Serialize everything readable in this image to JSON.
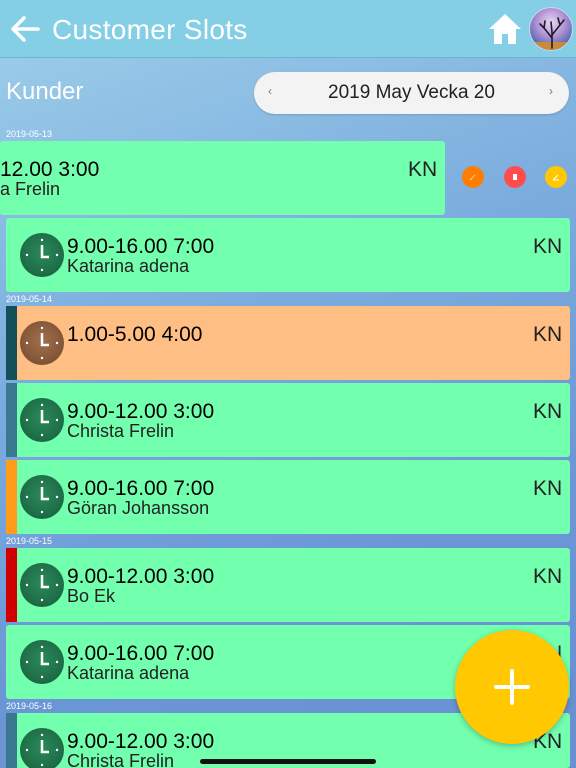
{
  "header": {
    "title": "Customer Slots",
    "back_icon": "arrow-left-icon",
    "home_icon": "home-icon",
    "avatar_icon": "tree-avatar-icon"
  },
  "subheader": {
    "label": "Kunder",
    "week_label": "2019 May Vecka 20",
    "prev": "‹",
    "next": "›"
  },
  "dates": [
    "2019-05-13",
    "2019-05-14",
    "2019-05-15",
    "2019-05-16"
  ],
  "slots": [
    {
      "time": "12.00 3:00",
      "name": "a Frelin",
      "initials": "KN",
      "color": "#72ffae"
    },
    {
      "time": "9.00-16.00 7:00",
      "name": "Katarina adena",
      "initials": "KN",
      "color": "#72ffae"
    },
    {
      "time": "1.00-5.00 4:00",
      "name": "",
      "initials": "KN",
      "color": "#ffbe84",
      "accent": "#14505a"
    },
    {
      "time": "9.00-12.00 3:00",
      "name": "Christa Frelin",
      "initials": "KN",
      "color": "#72ffae",
      "accent": "#3a7891"
    },
    {
      "time": "9.00-16.00 7:00",
      "name": "Göran Johansson",
      "initials": "KN",
      "color": "#72ffae",
      "accent": "#ff9d1a"
    },
    {
      "time": "9.00-12.00 3:00",
      "name": "Bo Ek",
      "initials": "KN",
      "color": "#72ffae",
      "accent": "#d10000"
    },
    {
      "time": "9.00-16.00 7:00",
      "name": "Katarina adena",
      "initials": "KN",
      "color": "#72ffae"
    },
    {
      "time": "9.00-12.00 3:00",
      "name": "Christa Frelin",
      "initials": "KN",
      "color": "#72ffae",
      "accent": "#3a7891"
    }
  ],
  "swipe_actions": {
    "colors": [
      "#ff7d00",
      "#ff4d4d",
      "#ffc800"
    ],
    "icons": [
      "edit-icon",
      "delete-icon",
      "edit-note-icon"
    ]
  },
  "fab": {
    "icon": "plus-icon",
    "color": "#ffc800"
  }
}
